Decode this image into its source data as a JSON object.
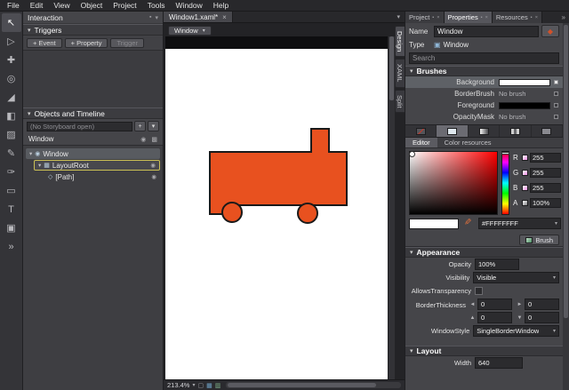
{
  "icons": {
    "caret_down": "▾",
    "close": "×",
    "pin": "▪",
    "chevrons": "»",
    "eye": "◉",
    "lock": "▩",
    "plus": "+",
    "circle": "◉",
    "window": "▣",
    "grid_node": "▦",
    "path_node": "◇",
    "arrow_left": "◄",
    "arrow_right": "►",
    "arrow_up": "▲",
    "arrow_down": "▼",
    "eyedropper": "✎",
    "resource": "◆",
    "fit": "▢",
    "grid": "▦",
    "snap": "▥"
  },
  "menu": [
    "File",
    "Edit",
    "View",
    "Object",
    "Project",
    "Tools",
    "Window",
    "Help"
  ],
  "toolbox": [
    {
      "name": "selection",
      "glyph": "↖"
    },
    {
      "name": "direct-selection",
      "glyph": "▷"
    },
    {
      "name": "pan",
      "glyph": "✚"
    },
    {
      "name": "zoom",
      "glyph": "◎"
    },
    {
      "name": "eyedropper",
      "glyph": "◢"
    },
    {
      "name": "paint-bucket",
      "glyph": "◧"
    },
    {
      "name": "gradient",
      "glyph": "▨"
    },
    {
      "name": "brush",
      "glyph": "✎"
    },
    {
      "name": "pen",
      "glyph": "✑"
    },
    {
      "name": "rectangle",
      "glyph": "▭"
    },
    {
      "name": "text",
      "glyph": "T"
    },
    {
      "name": "controls",
      "glyph": "▣"
    },
    {
      "name": "asset-library",
      "glyph": "»"
    }
  ],
  "interaction": {
    "title": "Interaction",
    "triggers_header": "Triggers",
    "trigger_buttons": [
      "+ Event",
      "+ Property",
      "Trigger"
    ],
    "objects_header": "Objects and Timeline",
    "storyboard_placeholder": "(No Storyboard open)",
    "scope_label": "Window",
    "tree": [
      {
        "label": "Window"
      },
      {
        "label": "LayoutRoot"
      },
      {
        "label": "[Path]"
      }
    ]
  },
  "document": {
    "tab_title": "Window1.xaml*",
    "breadcrumb": "Window",
    "artboard_tabs": [
      "Design",
      "XAML",
      "Split"
    ],
    "zoom": "213.4%"
  },
  "shape": {
    "fill": "#E8511F",
    "stroke": "#1A1A1A"
  },
  "colors": {
    "selection_outline": "#CABF55",
    "accent_orange": "#E8511F"
  },
  "properties": {
    "tabs": [
      "Project",
      "Properties",
      "Resources"
    ],
    "name_label": "Name",
    "name_value": "Window",
    "type_label": "Type",
    "type_value": "Window",
    "search_placeholder": "Search",
    "brushes": {
      "header": "Brushes",
      "rows": [
        {
          "label": "Background",
          "swatch": "#FFFFFF"
        },
        {
          "label": "BorderBrush",
          "value": "No brush"
        },
        {
          "label": "Foreground",
          "swatch": "#000000"
        },
        {
          "label": "OpacityMask",
          "value": "No brush"
        }
      ],
      "editor_tab": "Editor",
      "resources_tab": "Color resources",
      "channels": [
        {
          "label": "R",
          "value": "255"
        },
        {
          "label": "G",
          "value": "255"
        },
        {
          "label": "B",
          "value": "255"
        },
        {
          "label": "A",
          "value": "100%"
        }
      ],
      "hex": "#FFFFFFFF",
      "brush_button": "Brush"
    },
    "appearance": {
      "header": "Appearance",
      "opacity_label": "Opacity",
      "opacity_value": "100%",
      "visibility_label": "Visibility",
      "visibility_value": "Visible",
      "allows_transparency_label": "AllowsTransparency",
      "border_thickness_label": "BorderThickness",
      "border_values": [
        "0",
        "0",
        "0",
        "0"
      ],
      "window_style_label": "WindowStyle",
      "window_style_value": "SingleBorderWindow"
    },
    "layout": {
      "header": "Layout",
      "width_label": "Width",
      "width_value": "640"
    }
  }
}
